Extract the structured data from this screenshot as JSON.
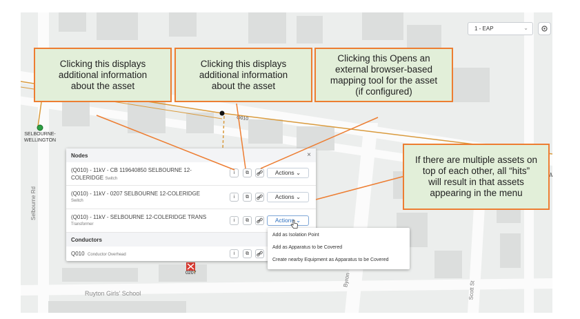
{
  "map": {
    "substation_label_1": "SELBOURNE-",
    "substation_label_2": "WELLINGTON",
    "feeder_label": "Q010",
    "street_selbourne": "Selbourne Rd",
    "street_byron": "Byron",
    "street_scott": "Scott St",
    "school_label": "Ruyton Girls' School",
    "marker_label": "0207",
    "edge_label": "W"
  },
  "toolbar": {
    "selector_value": "1 - EAP",
    "selector_icon": "chevron-down-icon",
    "locate_icon": "locate-icon"
  },
  "panel": {
    "nodes_title": "Nodes",
    "close_icon": "×",
    "conductors_title": "Conductors",
    "actions_label": "Actions",
    "info_icon": "i",
    "copy_icon": "⧉",
    "link_icon": "🔗",
    "node_rows": [
      {
        "name": "(Q010) - 11kV - CB 119640850 SELBOURNE 12-COLERIDGE",
        "type": "Switch"
      },
      {
        "name": "(Q010) - 11kV - 0207 SELBOURNE 12-COLERIDGE",
        "type": "Switch"
      },
      {
        "name": "(Q010) - 11kV - SELBOURNE 12-COLERIDGE TRANS",
        "type": "Transformer"
      }
    ],
    "conductor_rows": [
      {
        "name": "Q010",
        "type": "Conductor Overhead"
      }
    ]
  },
  "dropdown": {
    "items": [
      "Add as Isolation Point",
      "Add as Apparatus to be Covered",
      "Create nearby Equipment as Apparatus to be Covered"
    ]
  },
  "callouts": {
    "info1": [
      "Clicking this displays",
      "additional information",
      "about the asset"
    ],
    "info2": [
      "Clicking this displays",
      "additional information",
      "about the asset"
    ],
    "link": [
      "Clicking this Opens an",
      "external browser-based",
      "mapping tool for the asset",
      "(if configured)"
    ],
    "multi": [
      "If there are multiple assets on",
      "top of each other, all “hits”",
      "will result in that assets",
      "appearing in the menu"
    ]
  },
  "colors": {
    "callout_fill": "#e2efd9",
    "callout_border": "#ed7d31",
    "feeder_line": "#d99a3c",
    "substation": "#2ea043",
    "marker": "#d73a31"
  }
}
